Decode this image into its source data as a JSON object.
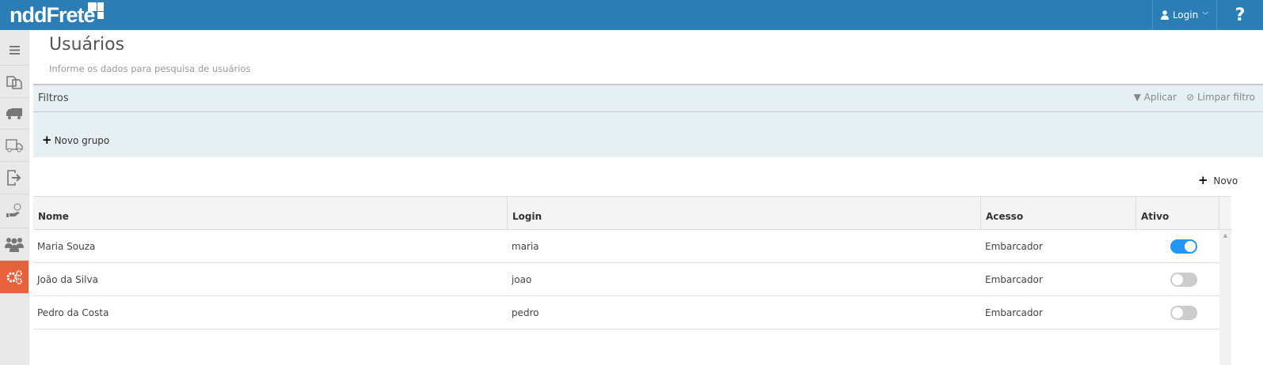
{
  "app": {
    "logo": "nddFrete",
    "login_label": "Login",
    "help_label": "?"
  },
  "sidebar": {
    "items": [
      {
        "icon": "menu-icon"
      },
      {
        "icon": "documents-icon"
      },
      {
        "icon": "truck-icon"
      },
      {
        "icon": "delivery-truck-icon"
      },
      {
        "icon": "export-icon"
      },
      {
        "icon": "payment-icon"
      },
      {
        "icon": "users-icon"
      },
      {
        "icon": "gears-icon",
        "active": true
      }
    ]
  },
  "page": {
    "title": "Usuários",
    "subtitle": "Informe os dados para pesquisa de usuários"
  },
  "filters": {
    "title": "Filtros",
    "apply": "Aplicar",
    "clear": "Limpar filtro",
    "new_group": "Novo grupo"
  },
  "new_label": "Novo",
  "table": {
    "headers": [
      "Nome",
      "Login",
      "Acesso",
      "Ativo"
    ],
    "rows": [
      {
        "nome": "Maria Souza",
        "login": "maria",
        "acesso": "Embarcador",
        "ativo": true
      },
      {
        "nome": "João da Silva",
        "login": "joao",
        "acesso": "Embarcador",
        "ativo": false
      },
      {
        "nome": "Pedro da Costa",
        "login": "pedro",
        "acesso": "Embarcador",
        "ativo": false
      }
    ]
  },
  "colors": {
    "header": "#2a7db5",
    "active_sidebar": "#e8613d",
    "toggle_on": "#2196f3"
  }
}
